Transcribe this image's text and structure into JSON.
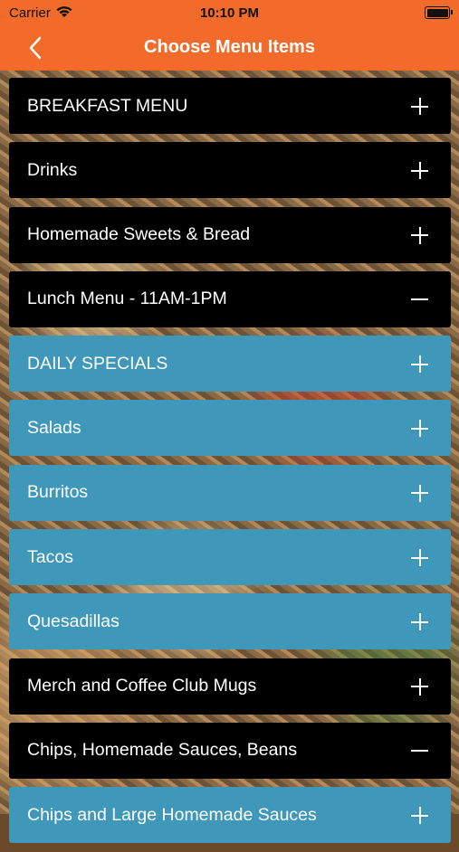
{
  "status": {
    "carrier": "Carrier",
    "time": "10:10 PM"
  },
  "nav": {
    "title": "Choose Menu Items"
  },
  "items": [
    {
      "label": "BREAKFAST MENU",
      "style": "black",
      "icon": "plus"
    },
    {
      "label": "Drinks",
      "style": "black",
      "icon": "plus"
    },
    {
      "label": "Homemade Sweets & Bread",
      "style": "black",
      "icon": "plus"
    },
    {
      "label": "Lunch Menu - 11AM-1PM",
      "style": "black",
      "icon": "minus"
    },
    {
      "label": "DAILY SPECIALS",
      "style": "blue",
      "icon": "plus"
    },
    {
      "label": "Salads",
      "style": "blue",
      "icon": "plus"
    },
    {
      "label": "Burritos",
      "style": "blue",
      "icon": "plus"
    },
    {
      "label": "Tacos",
      "style": "blue",
      "icon": "plus"
    },
    {
      "label": "Quesadillas",
      "style": "blue",
      "icon": "plus"
    },
    {
      "label": "Merch and Coffee Club Mugs",
      "style": "black",
      "icon": "plus"
    },
    {
      "label": "Chips, Homemade Sauces, Beans",
      "style": "black",
      "icon": "minus"
    },
    {
      "label": "Chips and Large Homemade Sauces",
      "style": "blue",
      "icon": "plus"
    }
  ],
  "colors": {
    "accent": "#f26b2a",
    "row_dark": "#000000",
    "row_blue": "#3f97ba"
  }
}
